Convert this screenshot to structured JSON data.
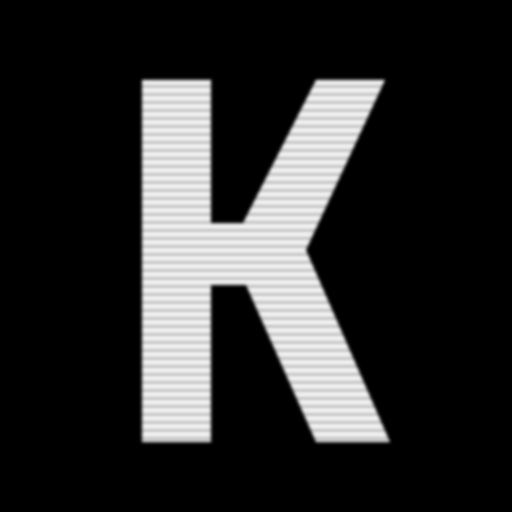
{
  "logo": {
    "letter": "K",
    "icon": "striped-letter-k-logo",
    "colors": {
      "background": "#000000",
      "letter_light": "#f2f2f2",
      "letter_mid": "#d9d9d9",
      "stripe": "#a9a9a9"
    }
  }
}
